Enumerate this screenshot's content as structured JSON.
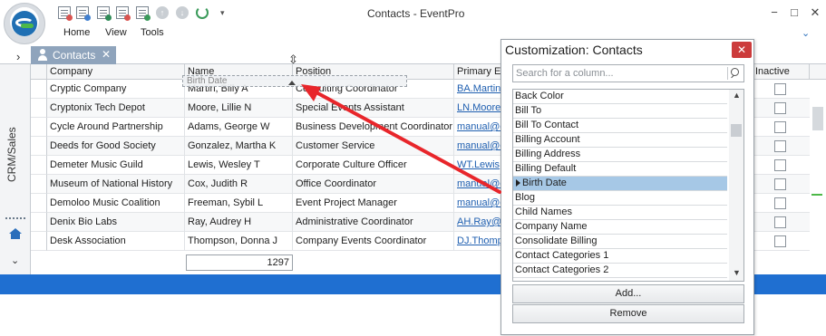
{
  "window": {
    "title": "Contacts - EventPro",
    "minimize": "−",
    "maximize": "□",
    "close": "✕"
  },
  "quick_access": {
    "up_glyph": "↑",
    "down_glyph": "↓",
    "dropdown_glyph": "▾"
  },
  "menu": {
    "items": [
      "Home",
      "View",
      "Tools"
    ],
    "collapse_glyph": "⌄"
  },
  "tab": {
    "label": "Contacts",
    "close": "✕",
    "collapse_glyph": "›"
  },
  "sidebar": {
    "module_label": "CRM/Sales",
    "down_glyph": "⌄"
  },
  "grid": {
    "columns": [
      "Company",
      "Name",
      "Position",
      "Primary Er",
      "Inactive"
    ],
    "rows": [
      {
        "company": "Cryptic Company",
        "name": "Martin, Billy A",
        "position": "Consulting Coordinator",
        "email": "BA.Martin"
      },
      {
        "company": "Cryptonix Tech Depot",
        "name": "Moore, Lillie N",
        "position": "Special Events Assistant",
        "email": "LN.Moore"
      },
      {
        "company": "Cycle Around Partnership",
        "name": "Adams, George W",
        "position": "Business Development Coordinator",
        "email": "manual@e"
      },
      {
        "company": "Deeds for Good Society",
        "name": "Gonzalez, Martha K",
        "position": "Customer Service",
        "email": "manual@e"
      },
      {
        "company": "Demeter Music Guild",
        "name": "Lewis, Wesley T",
        "position": "Corporate Culture Officer",
        "email": "WT.Lewis"
      },
      {
        "company": "Museum of National History",
        "name": "Cox, Judith R",
        "position": "Office Coordinator",
        "email": "manual@e"
      },
      {
        "company": "Demoloo Music Coalition",
        "name": "Freeman, Sybil L",
        "position": "Event Project Manager",
        "email": "manual@e"
      },
      {
        "company": "Denix Bio Labs",
        "name": "Ray, Audrey H",
        "position": "Administrative Coordinator",
        "email": "AH.Ray@e"
      },
      {
        "company": "Desk Association",
        "name": "Thompson, Donna J",
        "position": "Company Events Coordinator",
        "email": "DJ.Thomp"
      }
    ],
    "total_count": "1297",
    "drag_ghost": "Birth Date",
    "move_glyph": "⇳"
  },
  "customization": {
    "title": "Customization: Contacts",
    "close": "✕",
    "search_placeholder": "Search for a column...",
    "columns": [
      "Back Color",
      "Bill To",
      "Bill To Contact",
      "Billing Account",
      "Billing Address",
      "Billing Default",
      "Birth Date",
      "Blog",
      "Child Names",
      "Company Name",
      "Consolidate Billing",
      "Contact Categories 1",
      "Contact Categories 2"
    ],
    "selected_column": "Birth Date",
    "add_label": "Add...",
    "remove_label": "Remove",
    "scroll_up": "▲",
    "scroll_down": "▼"
  },
  "colors": {
    "accent": "#1f6fd1",
    "tab_bg": "#8fa4bc",
    "selection": "#a6c8e6",
    "close_red": "#cc3b3b",
    "arrow_red": "#e8262b",
    "link": "#1f5fb0"
  }
}
